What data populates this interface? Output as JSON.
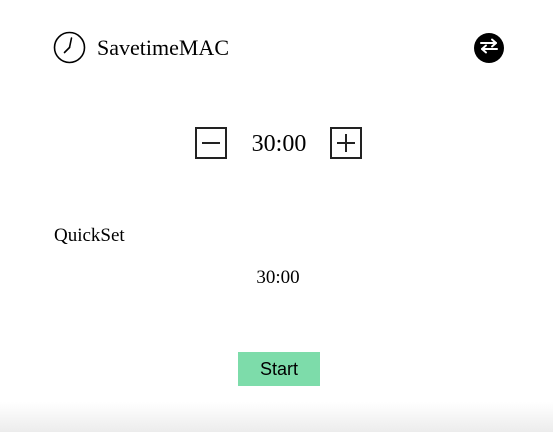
{
  "header": {
    "app_title": "SavetimeMAC",
    "logo_icon": "clock-icon",
    "swap_icon": "swap-arrows-icon"
  },
  "timer": {
    "value": "30:00",
    "decrement_icon": "minus-icon",
    "increment_icon": "plus-icon"
  },
  "quickset": {
    "label": "QuickSet",
    "options": [
      "30:00"
    ]
  },
  "actions": {
    "start_label": "Start"
  },
  "colors": {
    "start_button": "#7ddcaa",
    "text": "#000000",
    "background": "#ffffff"
  }
}
